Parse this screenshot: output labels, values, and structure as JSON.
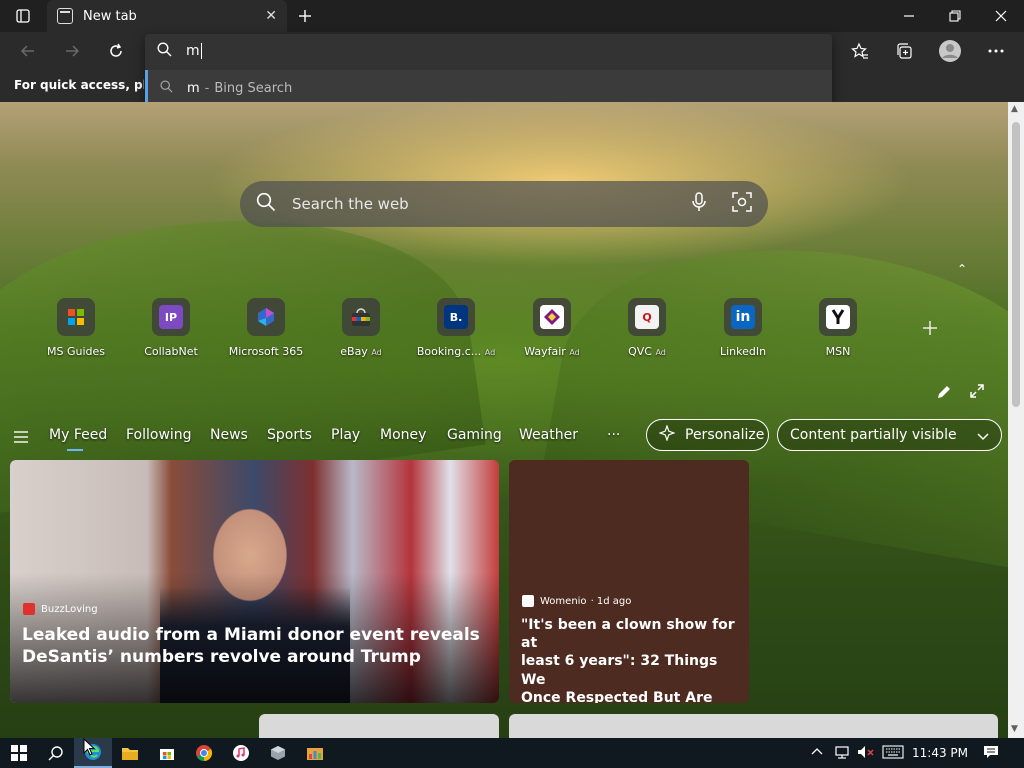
{
  "browser": {
    "tab_title": "New tab",
    "address_value": "m",
    "suggestion": {
      "term": "m",
      "separator": "-",
      "engine": "Bing Search"
    },
    "favorites_bar_text": "For quick access, place y"
  },
  "page": {
    "search_placeholder": "Search the web",
    "quick_links": [
      {
        "label": "MS Guides",
        "ad": "",
        "color": "#4a4a4a",
        "glyph": "▦"
      },
      {
        "label": "CollabNet",
        "ad": "",
        "color": "#7e4ac1",
        "glyph": "IP"
      },
      {
        "label": "Microsoft 365",
        "ad": "",
        "color": "#3569c9",
        "glyph": "◆"
      },
      {
        "label": "eBay",
        "ad": "Ad",
        "color": "#e53238",
        "glyph": "▬"
      },
      {
        "label": "Booking.c...",
        "ad": "Ad",
        "color": "#003580",
        "glyph": "B."
      },
      {
        "label": "Wayfair",
        "ad": "Ad",
        "color": "#7f187f",
        "glyph": "◈"
      },
      {
        "label": "QVC",
        "ad": "Ad",
        "color": "#f2f2f2",
        "glyph": "Q"
      },
      {
        "label": "LinkedIn",
        "ad": "",
        "color": "#0a66c2",
        "glyph": "in"
      },
      {
        "label": "MSN",
        "ad": "",
        "color": "#222222",
        "glyph": "𝒚"
      }
    ],
    "feed_nav": [
      "My Feed",
      "Following",
      "News",
      "Sports",
      "Play",
      "Money",
      "Gaming",
      "Weather"
    ],
    "more": "···",
    "personalize": "Personalize",
    "content_visibility": "Content partially visible",
    "cards": [
      {
        "source": "BuzzLoving",
        "meta": "",
        "headline_1": "Leaked audio from a Miami donor event reveals",
        "headline_2": "DeSantis’ numbers revolve around Trump"
      },
      {
        "source": "Womenio",
        "meta": "· 1d ago",
        "headline_1": "\"It's been a clown show for at",
        "headline_2": "least 6 years\": 32 Things We",
        "headline_3": "Once Respected But Are No..."
      }
    ]
  },
  "taskbar": {
    "time": "11:43 PM"
  },
  "colors": {
    "accent": "#6cb6ff",
    "taskbar": "#101820"
  }
}
